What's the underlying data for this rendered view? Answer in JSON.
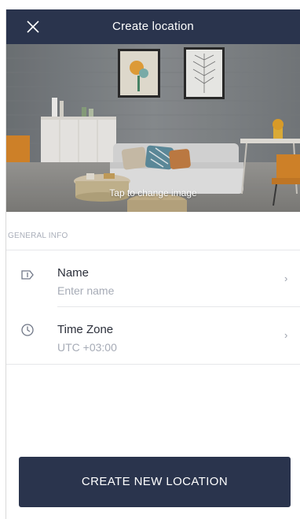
{
  "header": {
    "title": "Create location",
    "close_icon": "close-icon"
  },
  "photo": {
    "caption": "Tap to change image"
  },
  "general_info": {
    "section_label": "GENERAL INFO",
    "rows": [
      {
        "title": "Name",
        "value": "Enter name",
        "icon": "tag-icon",
        "chevron": "›"
      },
      {
        "title": "Time Zone",
        "value": "UTC +03:00",
        "icon": "clock-icon",
        "chevron": "›"
      }
    ]
  },
  "actions": {
    "create_label": "CREATE NEW LOCATION"
  },
  "colors": {
    "header_bg": "#2a344d",
    "button_bg": "#2a344d",
    "muted_text": "#a6abb6"
  }
}
